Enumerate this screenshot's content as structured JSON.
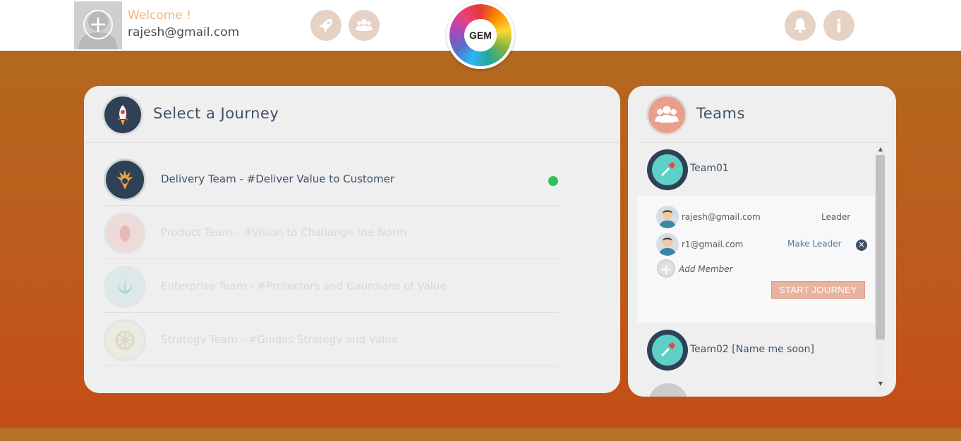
{
  "header": {
    "welcome": "Welcome !",
    "email": "rajesh@gmail.com",
    "logo_text": "GEM",
    "icons": [
      "rocket-icon",
      "users-icon",
      "bell-icon",
      "info-icon"
    ]
  },
  "journey": {
    "title": "Select a Journey",
    "items": [
      {
        "label": "Delivery Team - #Deliver Value to Customer",
        "active": true,
        "icon": "delivery-emblem-icon"
      },
      {
        "label": "Product Team - #Vision to Challange the Norm",
        "active": false,
        "icon": "rebel-emblem-icon"
      },
      {
        "label": "Enterprise Team - #Protectors and Gaurdians of Value",
        "active": false,
        "icon": "jedi-emblem-icon"
      },
      {
        "label": "Strategy Team - #Guides Strategy and Value",
        "active": false,
        "icon": "imperial-emblem-icon"
      }
    ]
  },
  "teams": {
    "title": "Teams",
    "team1": {
      "name": "Team01",
      "members": [
        {
          "email": "rajesh@gmail.com",
          "role": "Leader"
        },
        {
          "email": "r1@gmail.com",
          "action": "Make Leader"
        }
      ],
      "add_member": "Add Member",
      "start_button": "START JOURNEY"
    },
    "team2": {
      "name": "Team02 [Name me soon]"
    }
  },
  "colors": {
    "accent": "#f0b580",
    "title": "#3f5166",
    "active_dot": "#2ec15a",
    "start_button": "#eab39f"
  }
}
